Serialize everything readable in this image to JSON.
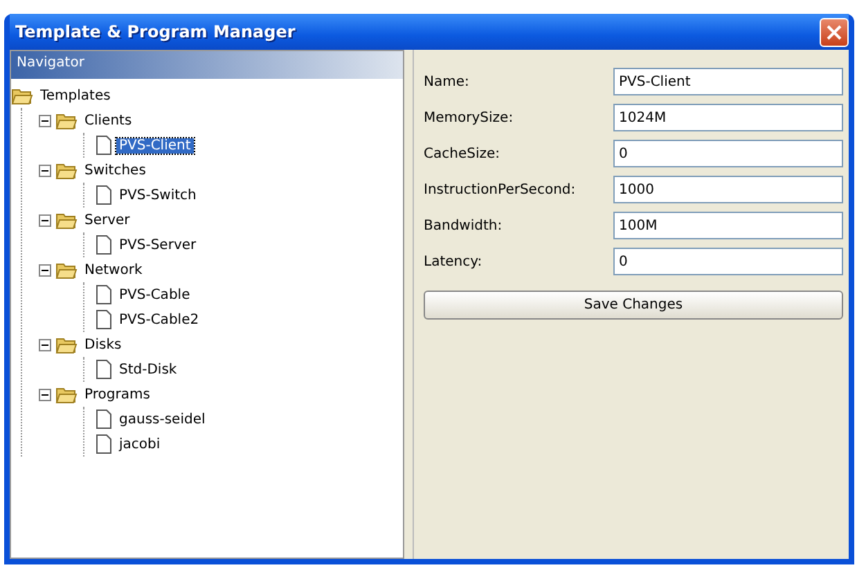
{
  "window": {
    "title": "Template & Program Manager"
  },
  "navigator": {
    "title": "Navigator",
    "tree": [
      {
        "label": "Templates",
        "kind": "folder",
        "expanded": true,
        "selected": false,
        "children": [
          {
            "label": "Clients",
            "kind": "folder",
            "expanded": true,
            "selected": false,
            "children": [
              {
                "label": "PVS-Client",
                "kind": "file",
                "selected": true
              }
            ]
          },
          {
            "label": "Switches",
            "kind": "folder",
            "expanded": true,
            "selected": false,
            "children": [
              {
                "label": "PVS-Switch",
                "kind": "file",
                "selected": false
              }
            ]
          },
          {
            "label": "Server",
            "kind": "folder",
            "expanded": true,
            "selected": false,
            "children": [
              {
                "label": "PVS-Server",
                "kind": "file",
                "selected": false
              }
            ]
          },
          {
            "label": "Network",
            "kind": "folder",
            "expanded": true,
            "selected": false,
            "children": [
              {
                "label": "PVS-Cable",
                "kind": "file",
                "selected": false
              },
              {
                "label": "PVS-Cable2",
                "kind": "file",
                "selected": false
              }
            ]
          },
          {
            "label": "Disks",
            "kind": "folder",
            "expanded": true,
            "selected": false,
            "children": [
              {
                "label": "Std-Disk",
                "kind": "file",
                "selected": false
              }
            ]
          },
          {
            "label": "Programs",
            "kind": "folder",
            "expanded": true,
            "selected": false,
            "children": [
              {
                "label": "gauss-seidel",
                "kind": "file",
                "selected": false
              },
              {
                "label": "jacobi",
                "kind": "file",
                "selected": false
              }
            ]
          }
        ]
      }
    ]
  },
  "form": {
    "fields": [
      {
        "label": "Name:",
        "value": "PVS-Client"
      },
      {
        "label": "MemorySize:",
        "value": "1024M"
      },
      {
        "label": "CacheSize:",
        "value": "0"
      },
      {
        "label": "InstructionPerSecond:",
        "value": "1000"
      },
      {
        "label": "Bandwidth:",
        "value": "100M"
      },
      {
        "label": "Latency:",
        "value": "0"
      }
    ],
    "save_button": "Save Changes"
  }
}
